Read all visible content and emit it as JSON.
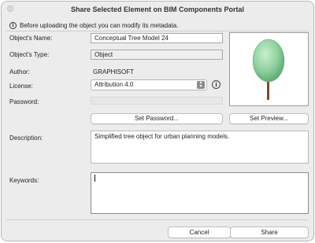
{
  "window": {
    "title": "Share Selected Element on BIM Components Portal"
  },
  "hint": {
    "text": "Before uploading the object you can modify its metadata.",
    "icon": "info-icon"
  },
  "form": {
    "name_label": "Object's Name:",
    "name_value": "Conceptual Tree Model 24",
    "type_label": "Object's Type:",
    "type_value": "Object",
    "author_label": "Author:",
    "author_value": "GRAPHISOFT",
    "license_label": "License:",
    "license_value": "Attribution 4.0",
    "password_label": "Password:",
    "description_label": "Description:",
    "description_value": "Simplified tree object for urban planning models.",
    "keywords_label": "Keywords:",
    "keywords_value": ""
  },
  "buttons": {
    "set_password": "Set Password...",
    "set_preview": "Set Preview...",
    "cancel": "Cancel",
    "share": "Share"
  },
  "colors": {
    "tree_canopy": "#8fd19e",
    "tree_trunk": "#7b4a2a"
  }
}
